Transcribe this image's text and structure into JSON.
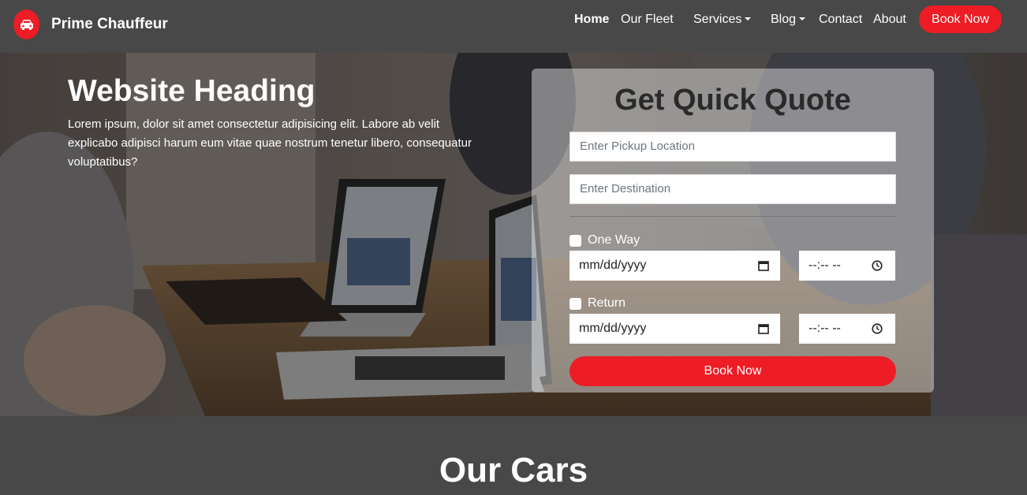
{
  "navbar": {
    "brand": "Prime Chauffeur",
    "brand_icon": "car-icon",
    "items": [
      {
        "label": "Home",
        "active": true
      },
      {
        "label": "Our Fleet"
      },
      {
        "label": "Services",
        "dropdown": true
      },
      {
        "label": "Blog",
        "dropdown": true
      },
      {
        "label": "Contact"
      },
      {
        "label": "About"
      }
    ],
    "cta": "Book Now"
  },
  "hero": {
    "heading": "Website Heading",
    "text": "Lorem ipsum, dolor sit amet consectetur adipisicing elit. Labore ab velit explicabo adipisci harum eum vitae quae nostrum tenetur libero, consequatur voluptatibus?"
  },
  "quote": {
    "title": "Get Quick Quote",
    "pickup_placeholder": "Enter Pickup Location",
    "destination_placeholder": "Enter Destination",
    "one_way_label": "One Way",
    "return_label": "Return",
    "date_placeholder": "mm/dd/yyyy",
    "time_placeholder": "--:-- --",
    "submit": "Book Now"
  },
  "cars": {
    "title": "Our Cars"
  },
  "colors": {
    "accent": "#ee1c25",
    "nav_bg": "#484848"
  }
}
